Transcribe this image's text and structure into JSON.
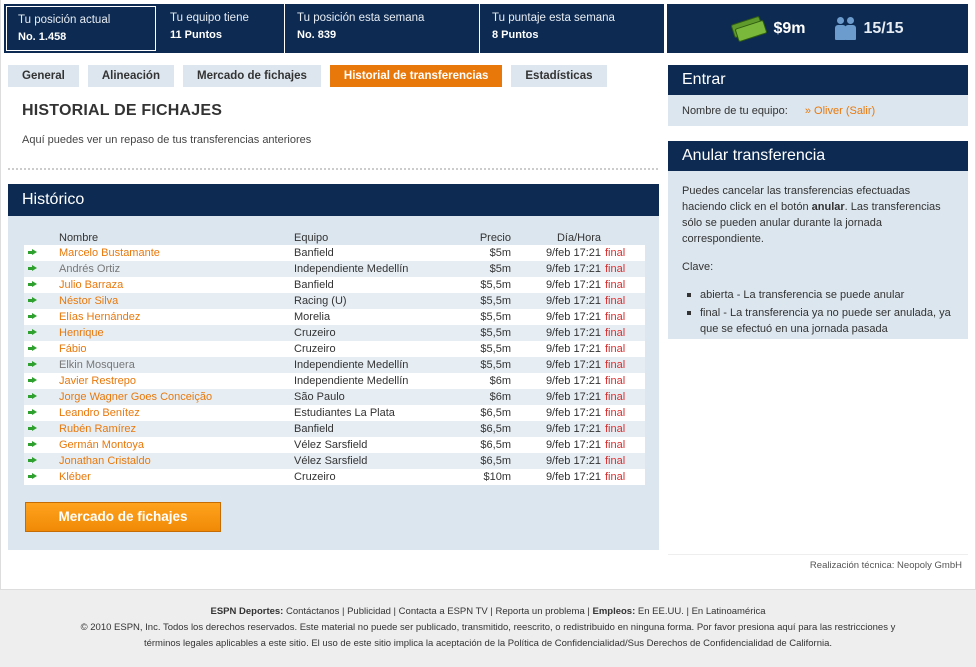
{
  "stats": [
    {
      "label": "Tu posición actual",
      "value": "No. 1.458"
    },
    {
      "label": "Tu equipo tiene",
      "value": "11 Puntos"
    },
    {
      "label": "Tu posición esta semana",
      "value": "No. 839"
    },
    {
      "label": "Tu puntaje esta semana",
      "value": "8 Puntos"
    }
  ],
  "budget": {
    "money": "$9m",
    "players": "15/15",
    "icons": [
      "money-icon",
      "players-icon"
    ]
  },
  "tabs": [
    "General",
    "Alineación",
    "Mercado de fichajes",
    "Historial de transferencias",
    "Estadísticas"
  ],
  "active_tab": "Historial de transferencias",
  "page": {
    "title": "HISTORIAL DE FICHAJES",
    "intro": "Aquí puedes ver un repaso de tus transferencias anteriores"
  },
  "history": {
    "title": "Histórico",
    "headers": {
      "name": "Nombre",
      "team": "Equipo",
      "price": "Precio",
      "date": "Día/Hora"
    },
    "rows": [
      {
        "name": "Marcelo Bustamante",
        "team": "Banfield",
        "price": "$5m",
        "date": "9/feb 17:21",
        "state": "final"
      },
      {
        "name": "Andrés Ortiz",
        "team": "Independiente Medellín",
        "price": "$5m",
        "date": "9/feb 17:21",
        "state": "final"
      },
      {
        "name": "Julio Barraza",
        "team": "Banfield",
        "price": "$5,5m",
        "date": "9/feb 17:21",
        "state": "final"
      },
      {
        "name": "Néstor Silva",
        "team": "Racing (U)",
        "price": "$5,5m",
        "date": "9/feb 17:21",
        "state": "final"
      },
      {
        "name": "Elías Hernández",
        "team": "Morelia",
        "price": "$5,5m",
        "date": "9/feb 17:21",
        "state": "final"
      },
      {
        "name": "Henrique",
        "team": "Cruzeiro",
        "price": "$5,5m",
        "date": "9/feb 17:21",
        "state": "final"
      },
      {
        "name": "Fábio",
        "team": "Cruzeiro",
        "price": "$5,5m",
        "date": "9/feb 17:21",
        "state": "final"
      },
      {
        "name": "Elkin Mosquera",
        "team": "Independiente Medellín",
        "price": "$5,5m",
        "date": "9/feb 17:21",
        "state": "final"
      },
      {
        "name": "Javier Restrepo",
        "team": "Independiente Medellín",
        "price": "$6m",
        "date": "9/feb 17:21",
        "state": "final"
      },
      {
        "name": "Jorge Wagner Goes Conceição",
        "team": "São Paulo",
        "price": "$6m",
        "date": "9/feb 17:21",
        "state": "final"
      },
      {
        "name": "Leandro Benítez",
        "team": "Estudiantes La Plata",
        "price": "$6,5m",
        "date": "9/feb 17:21",
        "state": "final"
      },
      {
        "name": "Rubén Ramírez",
        "team": "Banfield",
        "price": "$6,5m",
        "date": "9/feb 17:21",
        "state": "final"
      },
      {
        "name": "Germán Montoya",
        "team": "Vélez Sarsfield",
        "price": "$6,5m",
        "date": "9/feb 17:21",
        "state": "final"
      },
      {
        "name": "Jonathan Cristaldo",
        "team": "Vélez Sarsfield",
        "price": "$6,5m",
        "date": "9/feb 17:21",
        "state": "final"
      },
      {
        "name": "Kléber",
        "team": "Cruzeiro",
        "price": "$10m",
        "date": "9/feb 17:21",
        "state": "final"
      }
    ],
    "button": "Mercado de fichajes"
  },
  "login": {
    "title": "Entrar",
    "label": "Nombre de tu equipo:",
    "user": "» Oliver (Salir)"
  },
  "cancel": {
    "title": "Anular transferencia",
    "text_pre": "Puedes cancelar las transferencias efectuadas haciendo click en el botón ",
    "text_bold": "anular",
    "text_post": ". Las transferencias sólo se pueden anular durante la jornada correspondiente.",
    "clave": "Clave:",
    "items": [
      "abierta - La transferencia se puede anular",
      "final - La transferencia ya no puede ser anulada, ya que se efectuó en una jornada pasada"
    ]
  },
  "credit": "Realización técnica: Neopoly GmbH",
  "footer": {
    "line1_brand": "ESPN Deportes:",
    "line1_links": [
      "Contáctanos",
      "Publicidad",
      "Contacta a ESPN TV",
      "Reporta un problema"
    ],
    "line1_jobs": "Empleos:",
    "line1_job_links": [
      "En EE.UU.",
      "En Latinoamérica"
    ],
    "line2": "© 2010 ESPN, Inc. Todos los derechos reservados. Este material no puede ser publicado, transmitido, reescrito, o redistribuido en ninguna forma. Por favor presiona aquí para las restricciones y",
    "line3": "términos legales aplicables a este sitio. El uso de este sitio implica la aceptación de la Política de Confidencialidad/Sus Derechos de Confidencialidad de California."
  }
}
